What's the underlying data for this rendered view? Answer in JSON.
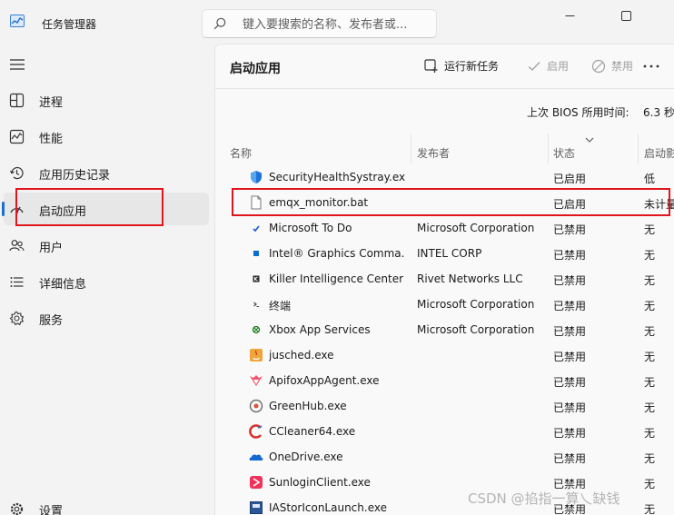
{
  "window": {
    "title": "任务管理器",
    "search_placeholder": "键入要搜索的名称、发布者或..."
  },
  "sidebar": {
    "items": [
      {
        "label": "进程",
        "icon": "processes-icon",
        "active": false
      },
      {
        "label": "性能",
        "icon": "performance-icon",
        "active": false
      },
      {
        "label": "应用历史记录",
        "icon": "app-history-icon",
        "active": false
      },
      {
        "label": "启动应用",
        "icon": "startup-apps-icon",
        "active": true
      },
      {
        "label": "用户",
        "icon": "users-icon",
        "active": false
      },
      {
        "label": "详细信息",
        "icon": "details-icon",
        "active": false
      },
      {
        "label": "服务",
        "icon": "services-icon",
        "active": false
      }
    ],
    "settings_label": "设置"
  },
  "main": {
    "title": "启动应用",
    "toolbar": {
      "run_new_task": "运行新任务",
      "enable": "启用",
      "disable": "禁用"
    },
    "bios_label": "上次 BIOS 所用时间:",
    "bios_value": "6.3 秒",
    "columns": {
      "name": "名称",
      "publisher": "发布者",
      "status": "状态",
      "impact": "启动影响"
    },
    "rows": [
      {
        "name": "SecurityHealthSystray.exe",
        "publisher": "",
        "status": "已启用",
        "impact": "低",
        "icon": "shield-icon"
      },
      {
        "name": "emqx_monitor.bat",
        "publisher": "",
        "status": "已启用",
        "impact": "未计量",
        "icon": "file-icon"
      },
      {
        "name": "Microsoft To Do",
        "publisher": "Microsoft Corporation",
        "status": "已禁用",
        "impact": "无",
        "icon": "todo-icon"
      },
      {
        "name": "Intel® Graphics Comma...",
        "publisher": "INTEL CORP",
        "status": "已禁用",
        "impact": "无",
        "icon": "intel-icon"
      },
      {
        "name": "Killer Intelligence Center",
        "publisher": "Rivet Networks LLC",
        "status": "已禁用",
        "impact": "无",
        "icon": "killer-icon"
      },
      {
        "name": "终端",
        "publisher": "Microsoft Corporation",
        "status": "已禁用",
        "impact": "无",
        "icon": "terminal-icon"
      },
      {
        "name": "Xbox App Services",
        "publisher": "Microsoft Corporation",
        "status": "已禁用",
        "impact": "无",
        "icon": "xbox-icon"
      },
      {
        "name": "jusched.exe",
        "publisher": "",
        "status": "已禁用",
        "impact": "无",
        "icon": "java-icon"
      },
      {
        "name": "ApifoxAppAgent.exe",
        "publisher": "",
        "status": "已禁用",
        "impact": "无",
        "icon": "apifox-icon"
      },
      {
        "name": "GreenHub.exe",
        "publisher": "",
        "status": "已禁用",
        "impact": "无",
        "icon": "greenhub-icon"
      },
      {
        "name": "CCleaner64.exe",
        "publisher": "",
        "status": "已禁用",
        "impact": "无",
        "icon": "ccleaner-icon"
      },
      {
        "name": "OneDrive.exe",
        "publisher": "",
        "status": "已禁用",
        "impact": "无",
        "icon": "onedrive-icon"
      },
      {
        "name": "SunloginClient.exe",
        "publisher": "",
        "status": "已禁用",
        "impact": "无",
        "icon": "sunlogin-icon"
      },
      {
        "name": "IAStorIconLaunch.exe",
        "publisher": "",
        "status": "已禁用",
        "impact": "无",
        "icon": "iastor-icon"
      }
    ]
  },
  "watermark": "CSDN @掐指一算乀缺钱",
  "colors": {
    "accent": "#1b6fd0",
    "highlight_box": "#e0161c"
  }
}
